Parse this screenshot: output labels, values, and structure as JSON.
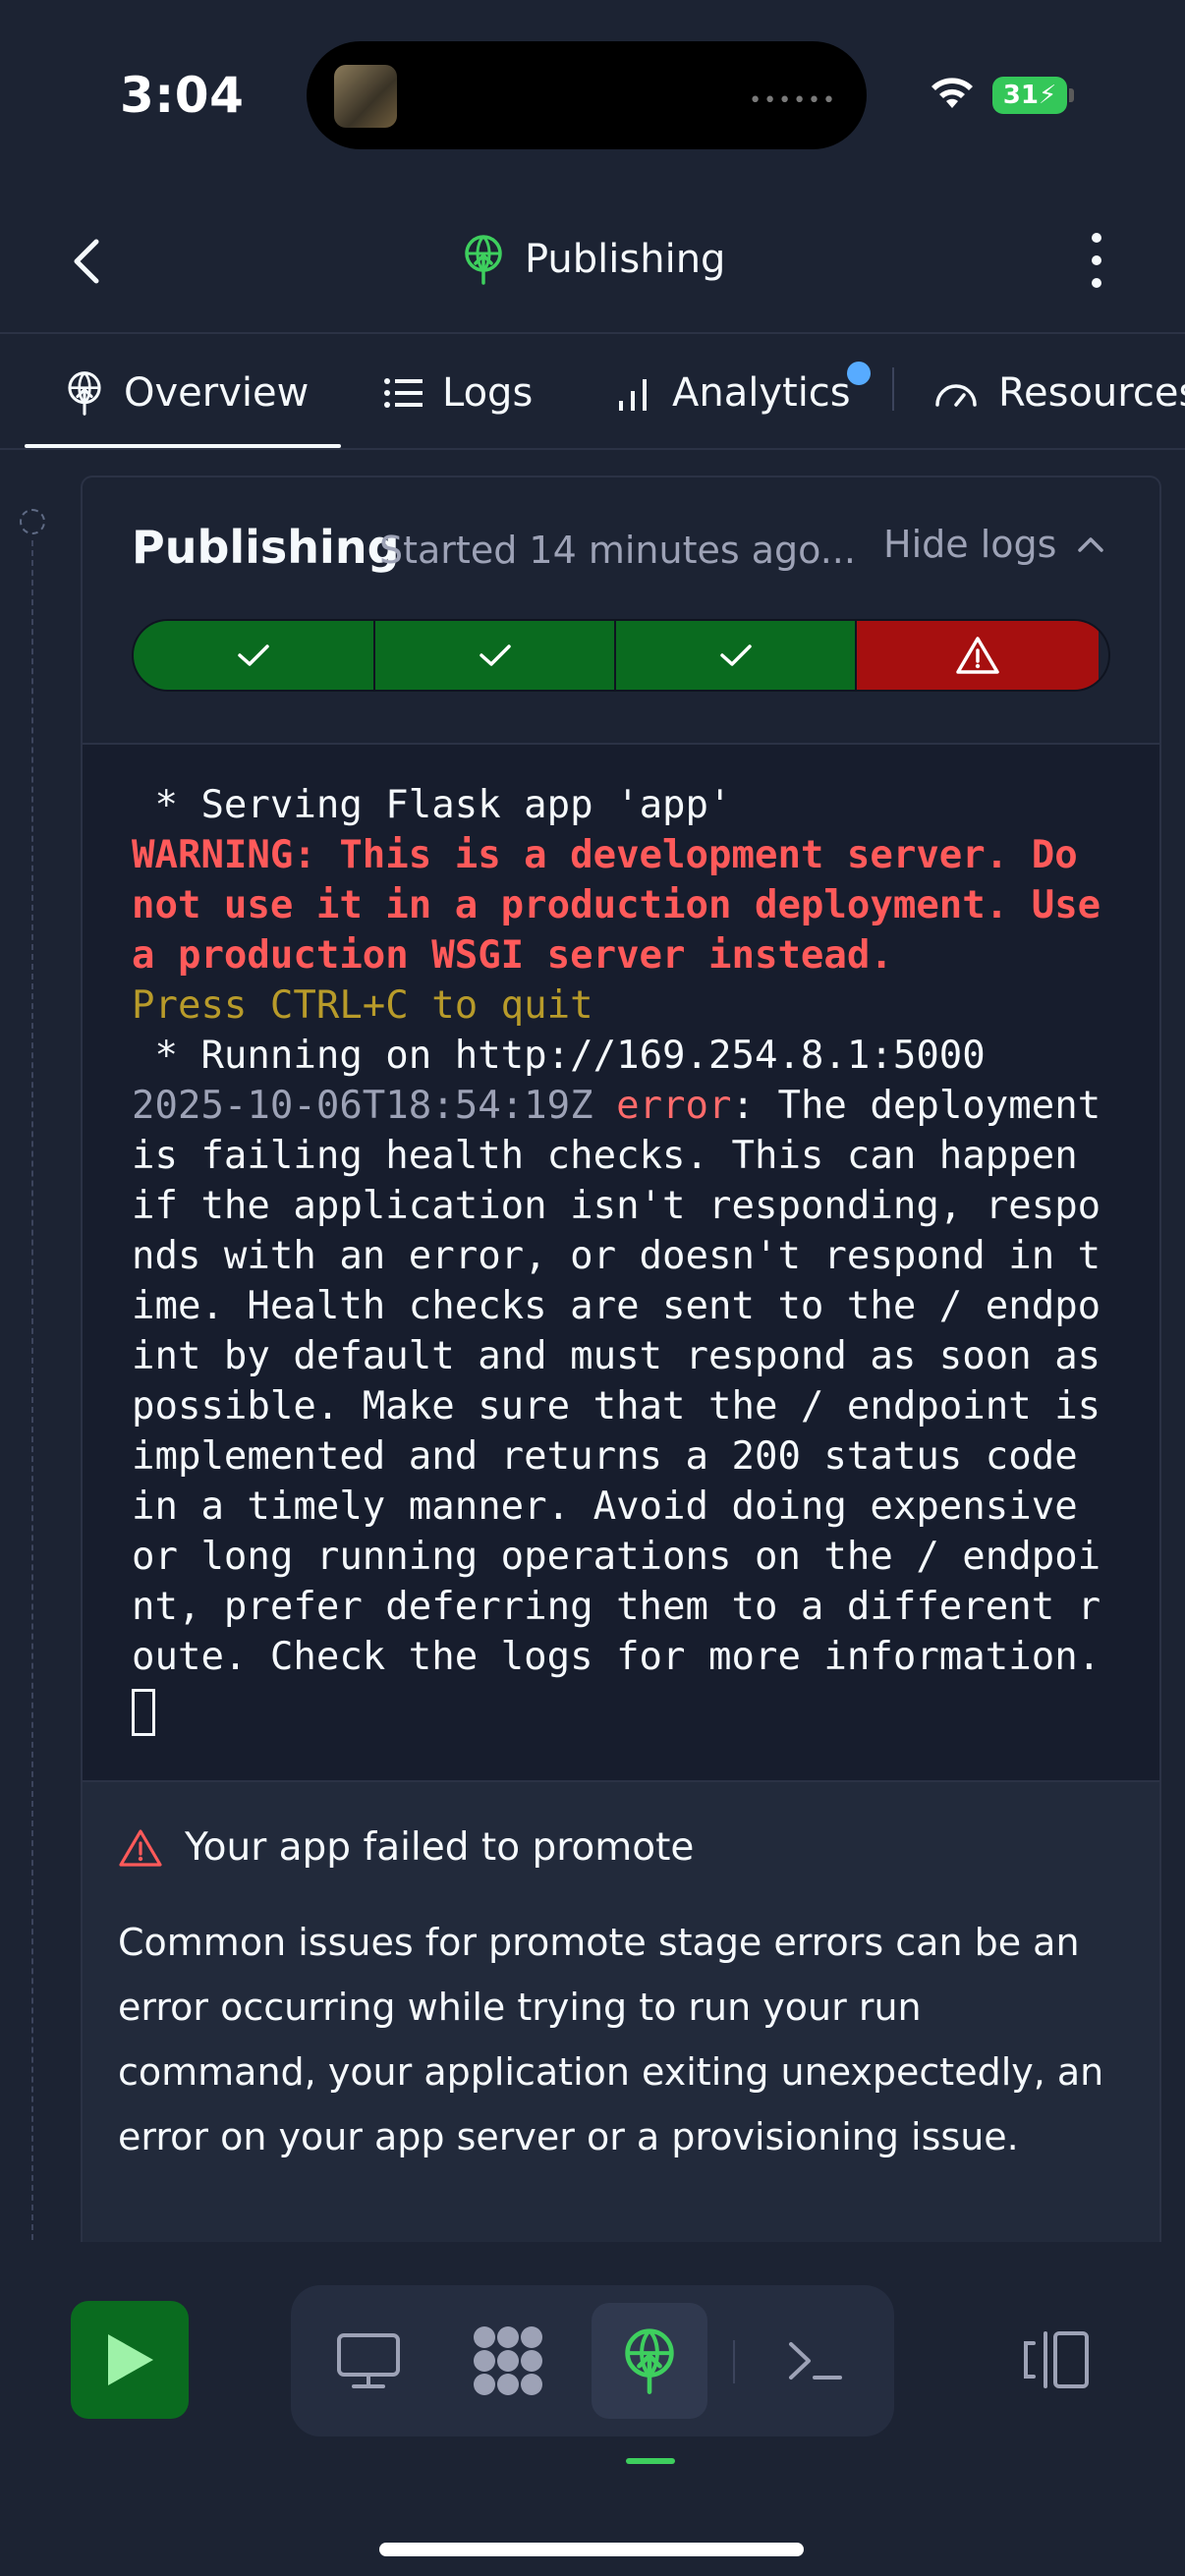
{
  "status_bar": {
    "time": "3:04",
    "battery": "31"
  },
  "nav": {
    "title": "Publishing"
  },
  "tabs": [
    {
      "label": "Overview",
      "icon": "deploy-icon",
      "active": true
    },
    {
      "label": "Logs",
      "icon": "list-icon",
      "active": false
    },
    {
      "label": "Analytics",
      "icon": "bar-chart-icon",
      "active": false,
      "has_notification": true
    },
    {
      "label": "Resources",
      "icon": "gauge-icon",
      "active": false
    }
  ],
  "card": {
    "title": "Publishing",
    "subtitle": "Started 14 minutes ago...",
    "hide_logs_label": "Hide logs",
    "stages": [
      {
        "status": "success"
      },
      {
        "status": "success"
      },
      {
        "status": "success"
      },
      {
        "status": "failed"
      }
    ]
  },
  "logs": {
    "line1": " * Serving Flask app 'app'",
    "line2": "WARNING: This is a development server. Do not use it in a production deployment. Use a production WSGI server instead.",
    "line3": "Press CTRL+C to quit",
    "line4": " * Running on http://169.254.8.1:5000",
    "line5_time": "2025-10-06T18:54:19Z",
    "line5_level": "error",
    "line5_message": ": The deployment is failing health checks. This can happen if the application isn't responding, responds with an error, or doesn't respond in time. Health checks are sent to the / endpoint by default and must respond as soon as possible. Make sure that the / endpoint is implemented and returns a 200 status code in a timely manner. Avoid doing expensive or long running operations on the / endpoint, prefer deferring them to a different route. Check the logs for more information."
  },
  "error": {
    "title": "Your app failed to promote",
    "body": "Common issues for promote stage errors can be an error occurring while trying to run your run command, your application exiting unexpectedly, an error on your app server or a provisioning issue."
  },
  "colors": {
    "accent_green": "#0a6b1f",
    "error_red": "#a60f0f",
    "background": "#1c2333"
  }
}
